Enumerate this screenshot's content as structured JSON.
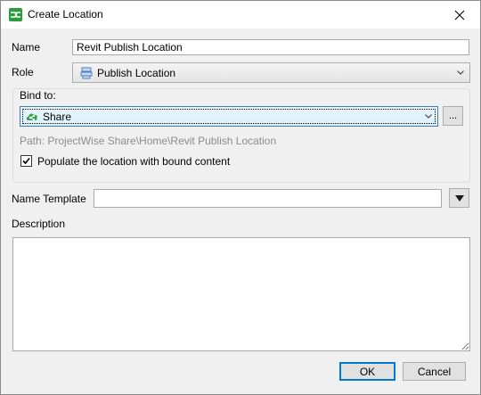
{
  "window": {
    "title": "Create Location",
    "close_glyph": "✕"
  },
  "form": {
    "name_label": "Name",
    "name_value": "Revit Publish Location",
    "role_label": "Role",
    "role_value": "Publish Location",
    "bind_group_label": "Bind to:",
    "bind_value": "Share",
    "bind_browse_label": "...",
    "path_text": "Path: ProjectWise Share\\Home\\Revit Publish Location",
    "populate_label": "Populate the location with bound content",
    "populate_checked": true,
    "name_template_label": "Name Template",
    "name_template_value": "",
    "description_label": "Description",
    "description_value": ""
  },
  "buttons": {
    "ok": "OK",
    "cancel": "Cancel"
  },
  "colors": {
    "app_icon": "#2e9a3e",
    "share_icon": "#3aa04a",
    "role_icon": "#4f7fc0"
  }
}
